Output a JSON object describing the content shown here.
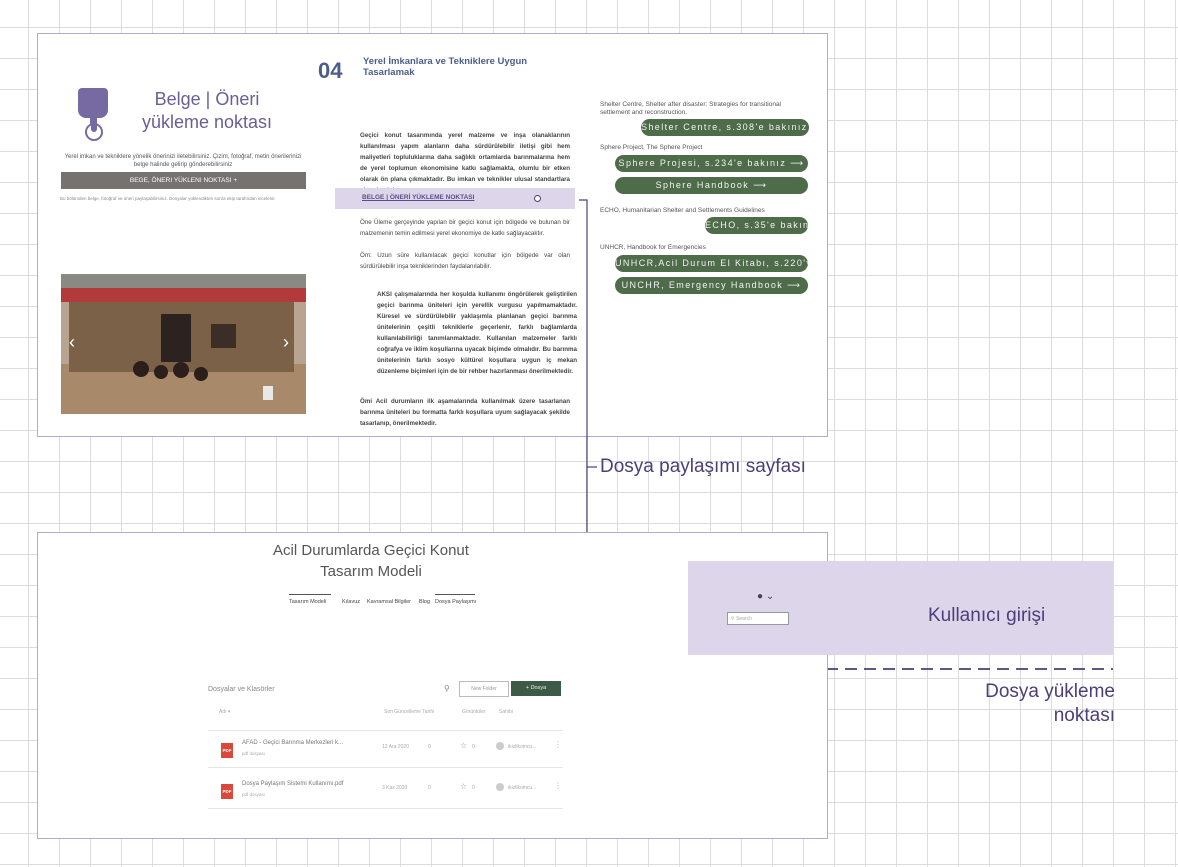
{
  "top_page": {
    "section_number": "04",
    "section_title": "Yerel İmkanlara ve Tekniklere Uygun Tasarlamak",
    "upload_title": "Belge | Öneri yükleme noktası",
    "upload_desc": "Yerel imkan ve tekniklere yönelik önerinizi iletebilirsiniz. Çizim, fotoğraf, metin önerilerinizi belge halinde gelirip gönderebilirsiniz",
    "upload_button": "BEGE, ÖNERI YÜKLENI NOKTASI",
    "upload_note": "Bu bölümden belge, fotoğraf ve öneri paylaşabilirsiniz. Dosyalar yüklendikten sonra ekip tarafından incelenir.",
    "bullet1": "Geçici konut tasarımında yerel malzeme ve inşa olanaklarının kullanılması yapım alanların daha sürdürülebilir iletişi gibi hem maliyetleri topluluklarına daha sağlıklı ortamlarda barınmalarına hem de yerel toplumun ekonomisine katkı sağlamakta, olumlu bir etken olarak ön plana çıkmaktadır. Bu imkan ve teknikler ulusal standartlara aktarılmalıdır.",
    "highlight_label": "BELGE | ÖNERİ YÜKLEME NOKTASI",
    "para2": "Öne Üleme gerçeyinde yapılan bir geçici konut için bölgede ve bulunan bir malzemenin temin edilmesi yerel ekonomiye de katkı sağlayacaktır.",
    "para3": "Öm: Uzun süre kullanılacak geçici konutlar için bölgede var olan sürdürülebilir inşa tekniklerinden faydalanılabilir.",
    "bullet2": "AKSI çalışmalarında her koşulda kullanımı öngörülerek geliştirilen geçici barınma üniteleri için yerellik vurgusu yapılmamaktadır. Küresel ve sürdürülebilir yaklaşımla planlanan geçici barınma ünitelerinin çeşitli tekniklerle geçerlenir, farklı bağlamlarda kullanılabilirliği tanımlanmaktadır. Kullanılan malzemeler farklı coğrafya ve iklim koşullarına uyacak biçimde olmalıdır. Bu barınma ünitelerinin farklı sosyo kültürel koşullara uygun iç mekan düzenleme biçimleri için de bir rehber hazırlanması önerilmektedir.",
    "para4": "Ömi Acil durumların ilk aşamalarında kullanılmak üzere tasarlanan barınma üniteleri bu formatta farklı koşullara uyum sağlayacak şekilde tasarlanıp, önerilmektedir.",
    "resources": [
      {
        "label": "Shelter Centre, Shelter after disaster: Strategies for transitional settlement and reconstruction.",
        "button": "Shelter Centre, s.308'e bakınız ⟶"
      },
      {
        "label": "Sphere Project, The Sphere Project",
        "button": "Sphere Projesi, s.234'e bakınız ⟶"
      },
      {
        "label": "",
        "button": "Sphere Handbook ⟶"
      },
      {
        "label": "ECHO, Humanitarian Shelter and Settlements Guidelines",
        "button": "ECHO, s.35'e bakınız ⟶"
      },
      {
        "label": "UNHCR, Handbook for Emergencies",
        "button": "UNHCR,Acil Durum El Kitabı, s.220'yo..."
      },
      {
        "label": "",
        "button": "UNCHR, Emergency Handbook ⟶"
      }
    ]
  },
  "annotations": {
    "file_share": "Dosya paylaşımı sayfası",
    "login": "Kullanıcı girişi",
    "upload_point": "Dosya yükleme noktası"
  },
  "bottom_page": {
    "title": "Acil Durumlarda Geçici Konut Tasarım Modeli",
    "nav": [
      "Tasarım Modeli",
      "Kılavuz",
      "Kavramsal Bilgiler",
      "Blog",
      "Dosya Paylaşımı"
    ],
    "search_placeholder": "Search",
    "section_label": "Dosyalar ve Klasörler",
    "new_button": "New Folder",
    "upload_button": "+ Dosya",
    "columns": [
      "Adı ▾",
      "Son Güncelleme Tarihi",
      "Görüntüler",
      "Sahibi"
    ],
    "files": [
      {
        "name": "AFAD - Geçici Barınma Merkezleri k...",
        "sub": "pdf dosyası",
        "date": "12 Ara 2020",
        "views": "0",
        "stars": "0",
        "owner": "ikizlikomcu..."
      },
      {
        "name": "Dosya Paylaşım Sistemi Kullanımı.pdf",
        "sub": "pdf dosyası",
        "date": "3 Kas 2020",
        "views": "0",
        "stars": "0",
        "owner": "ikizlikomcu..."
      }
    ]
  }
}
